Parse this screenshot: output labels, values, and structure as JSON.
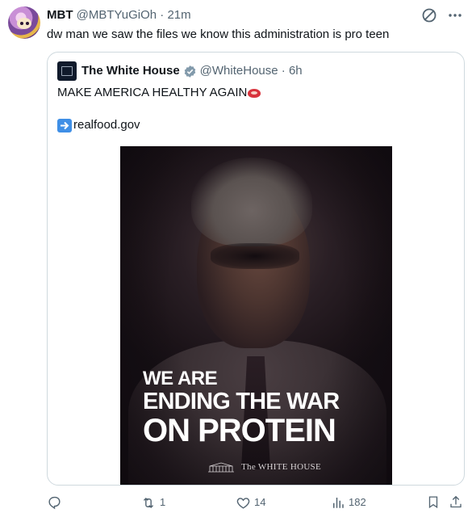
{
  "tweet": {
    "display_name": "MBT",
    "handle": "@MBTYuGiOh",
    "separator": "·",
    "time": "21m",
    "text": "dw man we saw the files we know this administration is pro teen"
  },
  "quoted_tweet": {
    "display_name": "The White House",
    "handle": "@WhiteHouse",
    "separator": "·",
    "time": "6h",
    "text": "MAKE AMERICA HEALTHY AGAIN",
    "link_text": "realfood.gov",
    "emoji_icon": "meat-icon",
    "link_icon": "arrow-right-icon",
    "verified_color": "#829aab",
    "poster": {
      "line1": "WE ARE",
      "line2": "ENDING THE WAR",
      "line3": "ON PROTEIN",
      "footer": "The WHITE HOUSE"
    }
  },
  "actions": {
    "replies": "",
    "reposts": "1",
    "likes": "14",
    "views": "182"
  },
  "colors": {
    "text_primary": "#0f1419",
    "text_secondary": "#536471",
    "border": "#cfd9de",
    "link_icon_bg": "#3f8fe6"
  }
}
